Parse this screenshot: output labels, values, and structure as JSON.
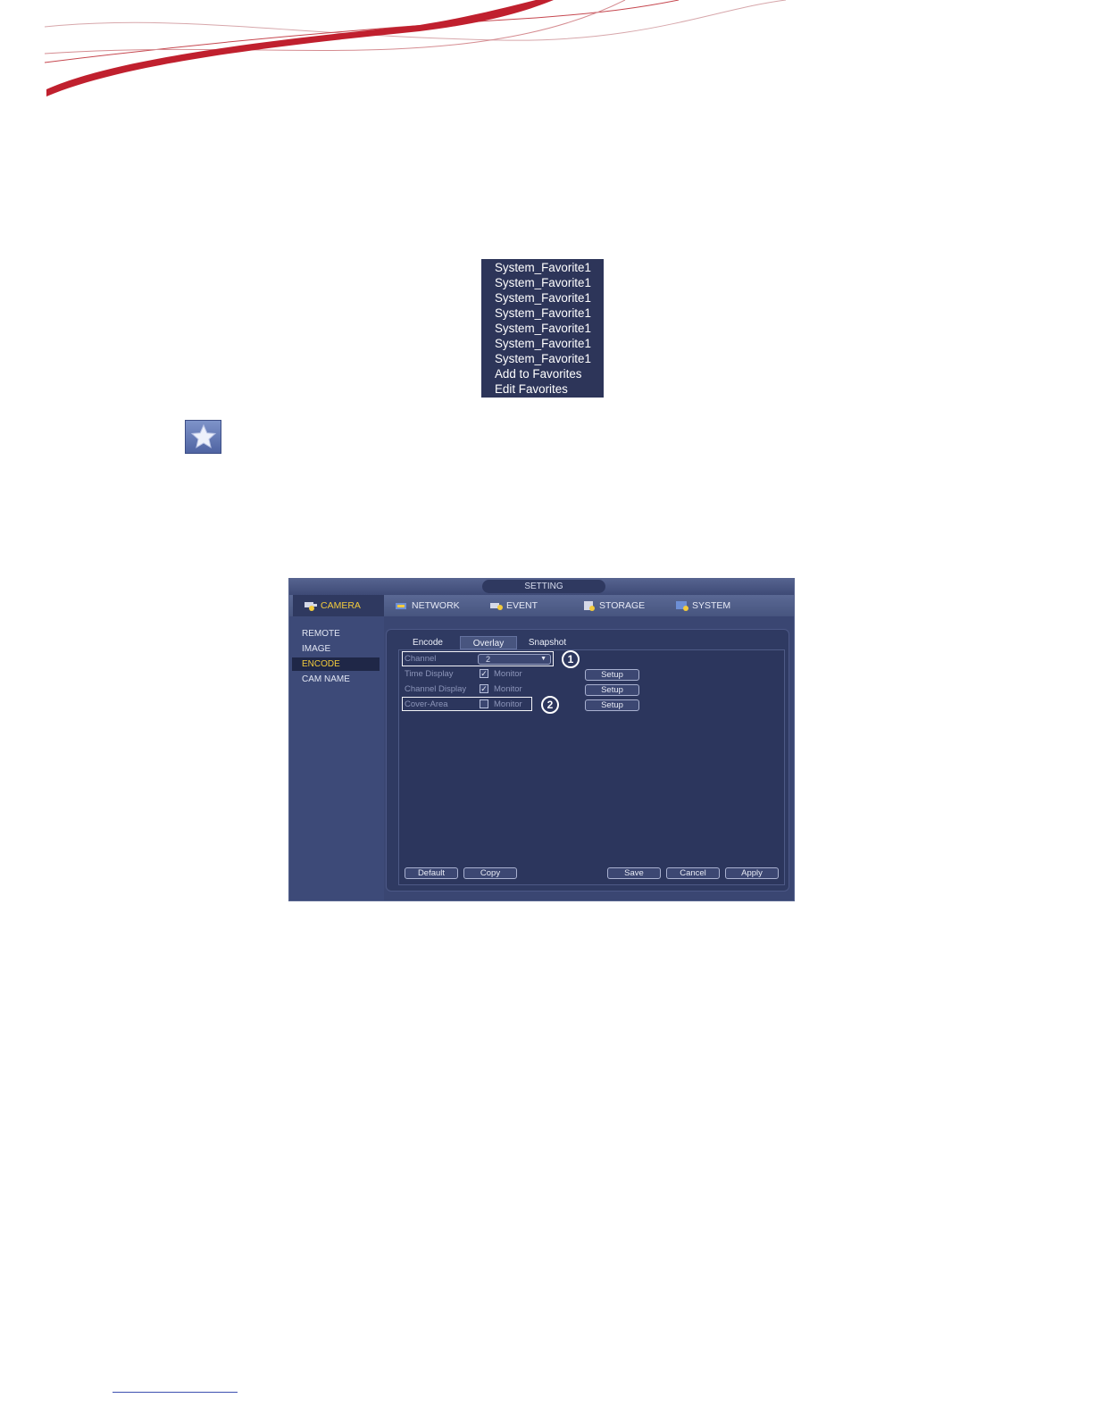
{
  "favorites_menu": {
    "items": [
      "System_Favorite1",
      "System_Favorite1",
      "System_Favorite1",
      "System_Favorite1",
      "System_Favorite1",
      "System_Favorite1",
      "System_Favorite1",
      "Add to Favorites",
      "Edit Favorites"
    ]
  },
  "star_button": {
    "icon": "star-icon"
  },
  "settings": {
    "title": "SETTING",
    "nav": {
      "camera": "CAMERA",
      "network": "NETWORK",
      "event": "EVENT",
      "storage": "STORAGE",
      "system": "SYSTEM"
    },
    "sidebar": [
      "REMOTE",
      "IMAGE",
      "ENCODE",
      "CAM NAME"
    ],
    "active_sidebar": "ENCODE",
    "tabs": [
      "Encode",
      "Overlay",
      "Snapshot"
    ],
    "active_tab": "Overlay",
    "channel": {
      "label": "Channel",
      "value": "2"
    },
    "rows": [
      {
        "label": "Time Display",
        "checked": true,
        "monitor": "Monitor",
        "setup": "Setup"
      },
      {
        "label": "Channel Display",
        "checked": true,
        "monitor": "Monitor",
        "setup": "Setup"
      },
      {
        "label": "Cover-Area",
        "checked": false,
        "monitor": "Monitor",
        "setup": "Setup"
      }
    ],
    "callouts": [
      "1",
      "2"
    ],
    "buttons": {
      "default": "Default",
      "copy": "Copy",
      "save": "Save",
      "cancel": "Cancel",
      "apply": "Apply"
    },
    "colors": {
      "accent": "#f3cb3c",
      "panel": "#2f3a62",
      "frame": "#3a4672"
    }
  },
  "decor": {
    "swoosh_color": "#c0202e"
  }
}
